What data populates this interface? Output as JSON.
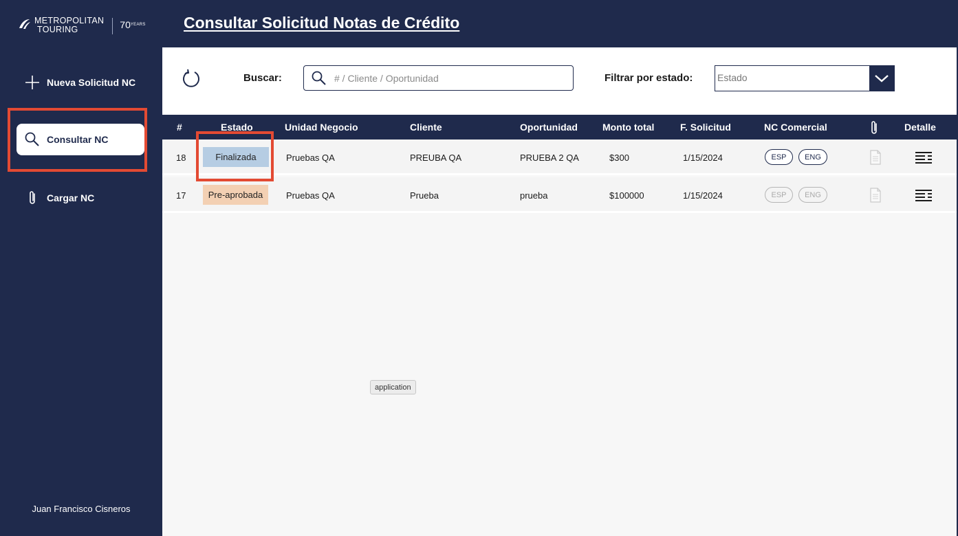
{
  "app": {
    "logo_line1": "METROPOLITAN",
    "logo_line2": "TOURING",
    "logo_years_num": "70",
    "logo_years_word": "YEARS"
  },
  "sidebar": {
    "items": [
      {
        "label": "Nueva Solicitud NC",
        "icon": "plus-icon"
      },
      {
        "label": "Consultar NC",
        "icon": "search-icon",
        "active": true
      },
      {
        "label": "Cargar NC",
        "icon": "paperclip-icon"
      }
    ],
    "user_name": "Juan Francisco Cisneros"
  },
  "header": {
    "title": "Consultar Solicitud Notas de Crédito"
  },
  "toolbar": {
    "buscar_label": "Buscar:",
    "search_placeholder": "# / Cliente / Oportunidad",
    "search_value": "",
    "filtrar_label": "Filtrar por estado:",
    "estado_value": "Estado"
  },
  "table": {
    "columns": [
      "#",
      "Estado",
      "Unidad Negocio",
      "Cliente",
      "Oportunidad",
      "Monto total",
      "F. Solicitud",
      "NC Comercial",
      "",
      "Detalle"
    ],
    "rows": [
      {
        "id": "18",
        "estado": "Finalizada",
        "unidad": "Pruebas QA",
        "cliente": "PREUBA QA",
        "oportunidad": "PRUEBA 2 QA",
        "monto": "$300",
        "fecha": "1/15/2024",
        "esp": "ESP",
        "eng": "ENG",
        "nc_enabled": true
      },
      {
        "id": "17",
        "estado": "Pre-aprobada",
        "unidad": "Pruebas QA",
        "cliente": "Prueba",
        "oportunidad": "prueba",
        "monto": "$100000",
        "fecha": "1/15/2024",
        "esp": "ESP",
        "eng": "ENG",
        "nc_enabled": false
      }
    ]
  },
  "tooltip": "application",
  "colors": {
    "navy": "#1f2a4c",
    "finalizada": "#b6cde3",
    "preaprobada": "#f3d0b3",
    "highlight": "#e34a33"
  }
}
